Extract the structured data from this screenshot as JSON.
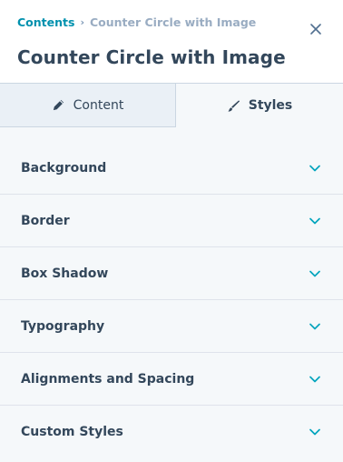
{
  "breadcrumb": {
    "root": "Contents",
    "separator": "›",
    "current": "Counter Circle with Image"
  },
  "header": {
    "title": "Counter Circle with Image",
    "close_icon": "close-icon"
  },
  "tabs": [
    {
      "label": "Content",
      "icon": "pencil-icon",
      "active": false
    },
    {
      "label": "Styles",
      "icon": "brush-icon",
      "active": true
    }
  ],
  "sections": [
    {
      "label": "Background"
    },
    {
      "label": "Border"
    },
    {
      "label": "Box Shadow"
    },
    {
      "label": "Typography"
    },
    {
      "label": "Alignments and Spacing"
    },
    {
      "label": "Custom Styles"
    }
  ],
  "colors": {
    "accent": "#00a4bd",
    "link": "#0091ae",
    "text": "#33475b",
    "muted": "#99acc2",
    "background": "#f5f8fa"
  }
}
